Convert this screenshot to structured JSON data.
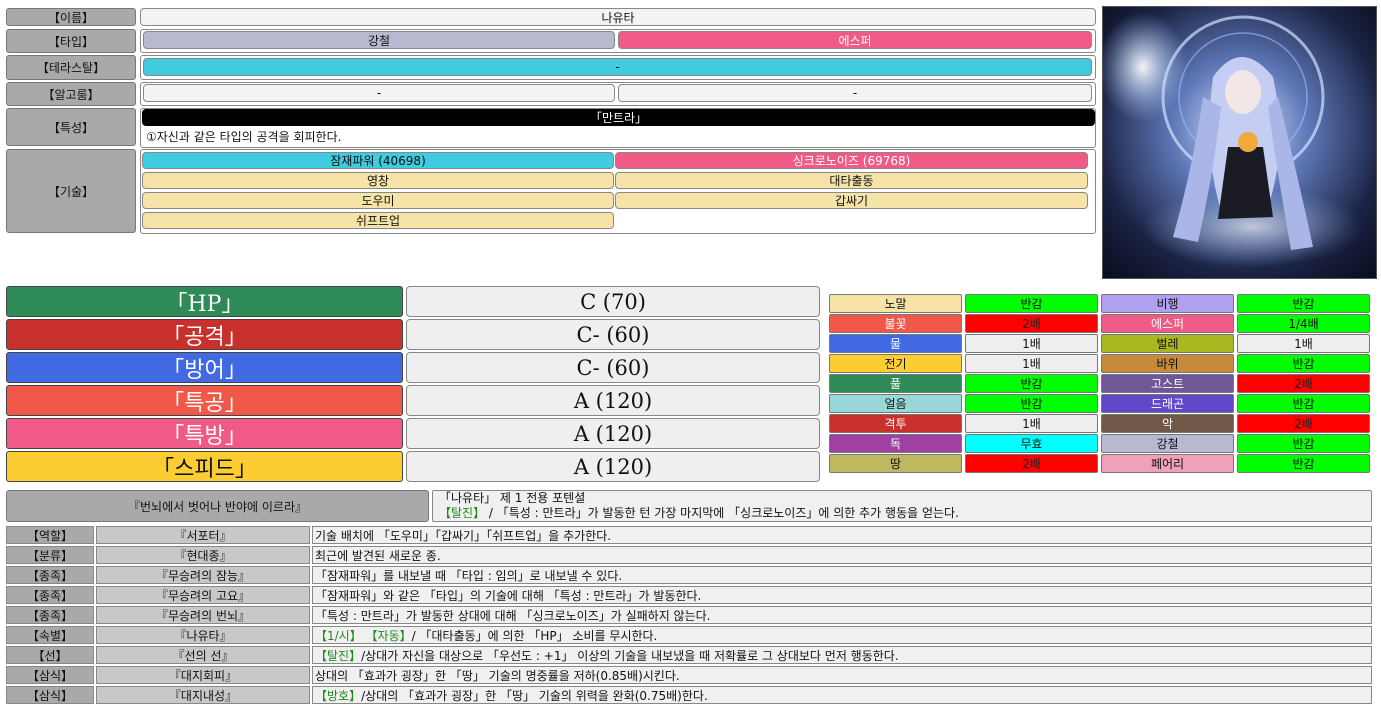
{
  "profile": {
    "name_label": "【이름】",
    "name": "나유타",
    "type_label": "【타입】",
    "type1": "강철",
    "type2": "에스퍼",
    "tera_label": "【테라스탈】",
    "tera": "-",
    "algo_label": "【알고룸】",
    "algo1": "-",
    "algo2": "-",
    "trait_label": "【특성】",
    "trait_name": "「만트라」",
    "trait_desc": "①자신과 같은 타입의 공격을 회피한다.",
    "skill_label": "【기술】",
    "skills": [
      "잠재파워 (40698)",
      "싱크로노이즈 (69768)",
      "영창",
      "대타출동",
      "도우미",
      "갑싸기",
      "쉬프트업"
    ]
  },
  "stats": [
    {
      "name": "「HP」",
      "value": "C (70)",
      "color": "#2e8b57"
    },
    {
      "name": "「공격」",
      "value": "C- (60)",
      "color": "#c8312b"
    },
    {
      "name": "「방어」",
      "value": "C- (60)",
      "color": "#4169e1"
    },
    {
      "name": "「특공」",
      "value": "A (120)",
      "color": "#f0584a"
    },
    {
      "name": "「특방」",
      "value": "A (120)",
      "color": "#f05a86"
    },
    {
      "name": "「스피드」",
      "value": "A (120)",
      "color": "#fbcd32"
    }
  ],
  "type_chart": [
    {
      "type": "노말",
      "type_color": "#f5e3a8",
      "eff": "반감",
      "eff_color": "#00ff00"
    },
    {
      "type": "비행",
      "type_color": "#b1a0f0",
      "eff": "반감",
      "eff_color": "#00ff00"
    },
    {
      "type": "불꽃",
      "type_color": "#f0584a",
      "eff": "2배",
      "eff_color": "#ff0000"
    },
    {
      "type": "에스퍼",
      "type_color": "#f05a86",
      "eff": "1/4배",
      "eff_color": "#00ff00"
    },
    {
      "type": "물",
      "type_color": "#4169e1",
      "eff": "1배",
      "eff_color": "#eeeeee"
    },
    {
      "type": "벌레",
      "type_color": "#a8b820",
      "eff": "1배",
      "eff_color": "#eeeeee"
    },
    {
      "type": "전기",
      "type_color": "#fbcd32",
      "eff": "1배",
      "eff_color": "#eeeeee"
    },
    {
      "type": "바위",
      "type_color": "#c78a3a",
      "eff": "반감",
      "eff_color": "#00ff00"
    },
    {
      "type": "풀",
      "type_color": "#2e8b57",
      "eff": "반감",
      "eff_color": "#00ff00"
    },
    {
      "type": "고스트",
      "type_color": "#705898",
      "eff": "2배",
      "eff_color": "#ff0000"
    },
    {
      "type": "얼음",
      "type_color": "#98d8d8",
      "eff": "반감",
      "eff_color": "#00ff00"
    },
    {
      "type": "드래곤",
      "type_color": "#6048c8",
      "eff": "반감",
      "eff_color": "#00ff00"
    },
    {
      "type": "격투",
      "type_color": "#c8312b",
      "eff": "1배",
      "eff_color": "#eeeeee"
    },
    {
      "type": "악",
      "type_color": "#705848",
      "eff": "2배",
      "eff_color": "#ff0000"
    },
    {
      "type": "독",
      "type_color": "#a040a0",
      "eff": "무효",
      "eff_color": "#00ffff"
    },
    {
      "type": "강철",
      "type_color": "#b8b8d0",
      "eff": "반감",
      "eff_color": "#00ff00"
    },
    {
      "type": "땅",
      "type_color": "#c0b860",
      "eff": "2배",
      "eff_color": "#ff0000"
    },
    {
      "type": "페어리",
      "type_color": "#f0a0b8",
      "eff": "반감",
      "eff_color": "#00ff00"
    }
  ],
  "potential": {
    "title": "『번뇌에서 벗어나 반야에 이르라』",
    "line1": "「나유타」 제 1 전용 포텐셜",
    "line2_tag": "【탈진】",
    "line2": " / 「특성 : 만트라」가 발동한 턴 가장 마지막에 「싱크로노이즈」에 의한 추가 행동을 얻는다."
  },
  "abilities": [
    {
      "cat": "【역할】",
      "name": "『서포터』",
      "tag": "",
      "desc": "기술 배치에 「도우미」「갑싸기」「쉬프트업」을 추가한다."
    },
    {
      "cat": "【분류】",
      "name": "『현대종』",
      "tag": "",
      "desc": "최근에 발견된 새로운 종."
    },
    {
      "cat": "【종족】",
      "name": "『무승려의 잠능』",
      "tag": "",
      "desc": "「잠재파워」를 내보낼 때 「타입 : 임의」로 내보낼 수 있다."
    },
    {
      "cat": "【종족】",
      "name": "『무승려의 고요』",
      "tag": "",
      "desc": "「잠재파워」와 같은 「타입」의 기술에 대해 「특성 : 만트라」가 발동한다."
    },
    {
      "cat": "【종족】",
      "name": "『무승려의 번뇌』",
      "tag": "",
      "desc": "「특성 : 만트라」가 발동한 상대에 대해 「싱크로노이즈」가 실패하지 않는다."
    },
    {
      "cat": "【속별】",
      "name": "『나유타』",
      "tag": "【1/시】 【자동】",
      "desc": " / 「대타출동」에 의한 「HP」 소비를 무시한다."
    },
    {
      "cat": "【선】",
      "name": "『선의 선』",
      "tag": "【탈진】",
      "desc": " /상대가 자신을 대상으로 「우선도 : +1」 이상의 기술을 내보냈을 때 저확률로 그 상대보다 먼저 행동한다."
    },
    {
      "cat": "【삼식】",
      "name": "『대지회피』",
      "tag": "",
      "desc": "상대의 「효과가 굉장」한 「땅」 기술의 명중률을 저하(0.85배)시킨다."
    },
    {
      "cat": "【삼식】",
      "name": "『대지내성』",
      "tag": "【방호】",
      "desc": " /상대의 「효과가 굉장」한 「땅」 기술의 위력을 완화(0.75배)한다."
    }
  ]
}
